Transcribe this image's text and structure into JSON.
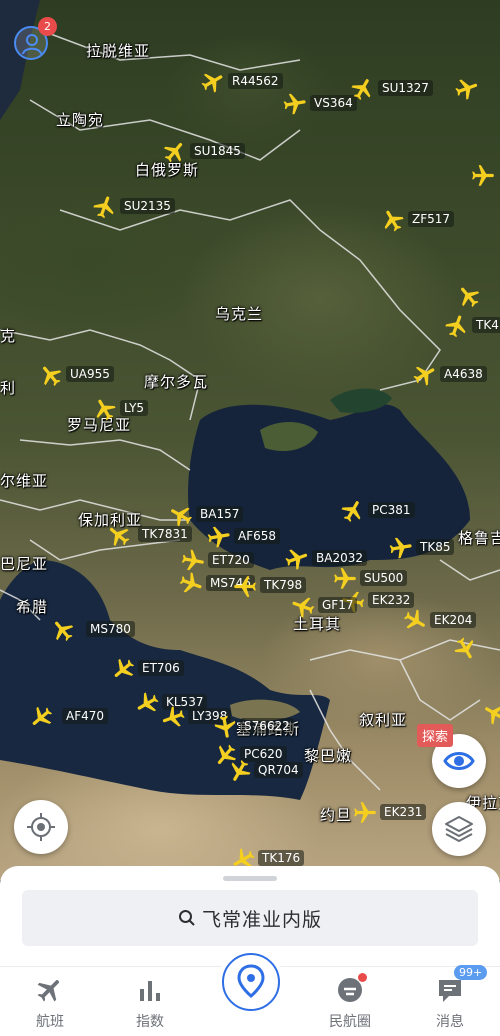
{
  "map": {
    "places": [
      {
        "id": "latvia",
        "label": "拉脱维亚"
      },
      {
        "id": "lithuania",
        "label": "立陶宛"
      },
      {
        "id": "belarus",
        "label": "白俄罗斯"
      },
      {
        "id": "ukraine",
        "label": "乌克兰"
      },
      {
        "id": "moldova",
        "label": "摩尔多瓦"
      },
      {
        "id": "romania",
        "label": "罗马尼亚"
      },
      {
        "id": "bulgaria",
        "label": "保加利亚"
      },
      {
        "id": "serbia",
        "label": "尔维亚"
      },
      {
        "id": "albania",
        "label": "巴尼亚"
      },
      {
        "id": "greece",
        "label": "希腊"
      },
      {
        "id": "turkey",
        "label": "土耳其"
      },
      {
        "id": "syria",
        "label": "叙利亚"
      },
      {
        "id": "lebanon",
        "label": "黎巴嫩"
      },
      {
        "id": "jordan",
        "label": "约旦"
      },
      {
        "id": "georgia",
        "label": "格鲁吉"
      },
      {
        "id": "iraq",
        "label": "伊拉克"
      },
      {
        "id": "cyprus",
        "label": "塞浦路斯"
      },
      {
        "id": "slovakia",
        "label": "克"
      },
      {
        "id": "hungary",
        "label": "利"
      }
    ],
    "flights": [
      "R44562",
      "VS364",
      "SU1327",
      "SU1845",
      "SU2135",
      "ZF517",
      "TK4",
      "A4638",
      "UA955",
      "LY5",
      "BA157",
      "TK7831",
      "AF658",
      "PC381",
      "TK85",
      "ET720",
      "BA2032",
      "MS746",
      "TK798",
      "SU500",
      "EK232",
      "GF17",
      "MS780",
      "EK204",
      "ET706",
      "KL537",
      "LY398",
      "AF470",
      "S76622",
      "PC620",
      "QR704",
      "EK231",
      "TK176"
    ]
  },
  "header": {
    "avatar_badge": "2"
  },
  "actions": {
    "explore_label": "探索"
  },
  "search": {
    "label": "飞常准业内版"
  },
  "tabs": [
    {
      "id": "flights",
      "label": "航班"
    },
    {
      "id": "index",
      "label": "指数"
    },
    {
      "id": "map",
      "label": ""
    },
    {
      "id": "civil",
      "label": "民航圈"
    },
    {
      "id": "messages",
      "label": "消息",
      "badge": "99+"
    }
  ],
  "colors": {
    "accent": "#2f6fe5",
    "plane": "#f4cf1f",
    "badge": "#e94b4b"
  }
}
